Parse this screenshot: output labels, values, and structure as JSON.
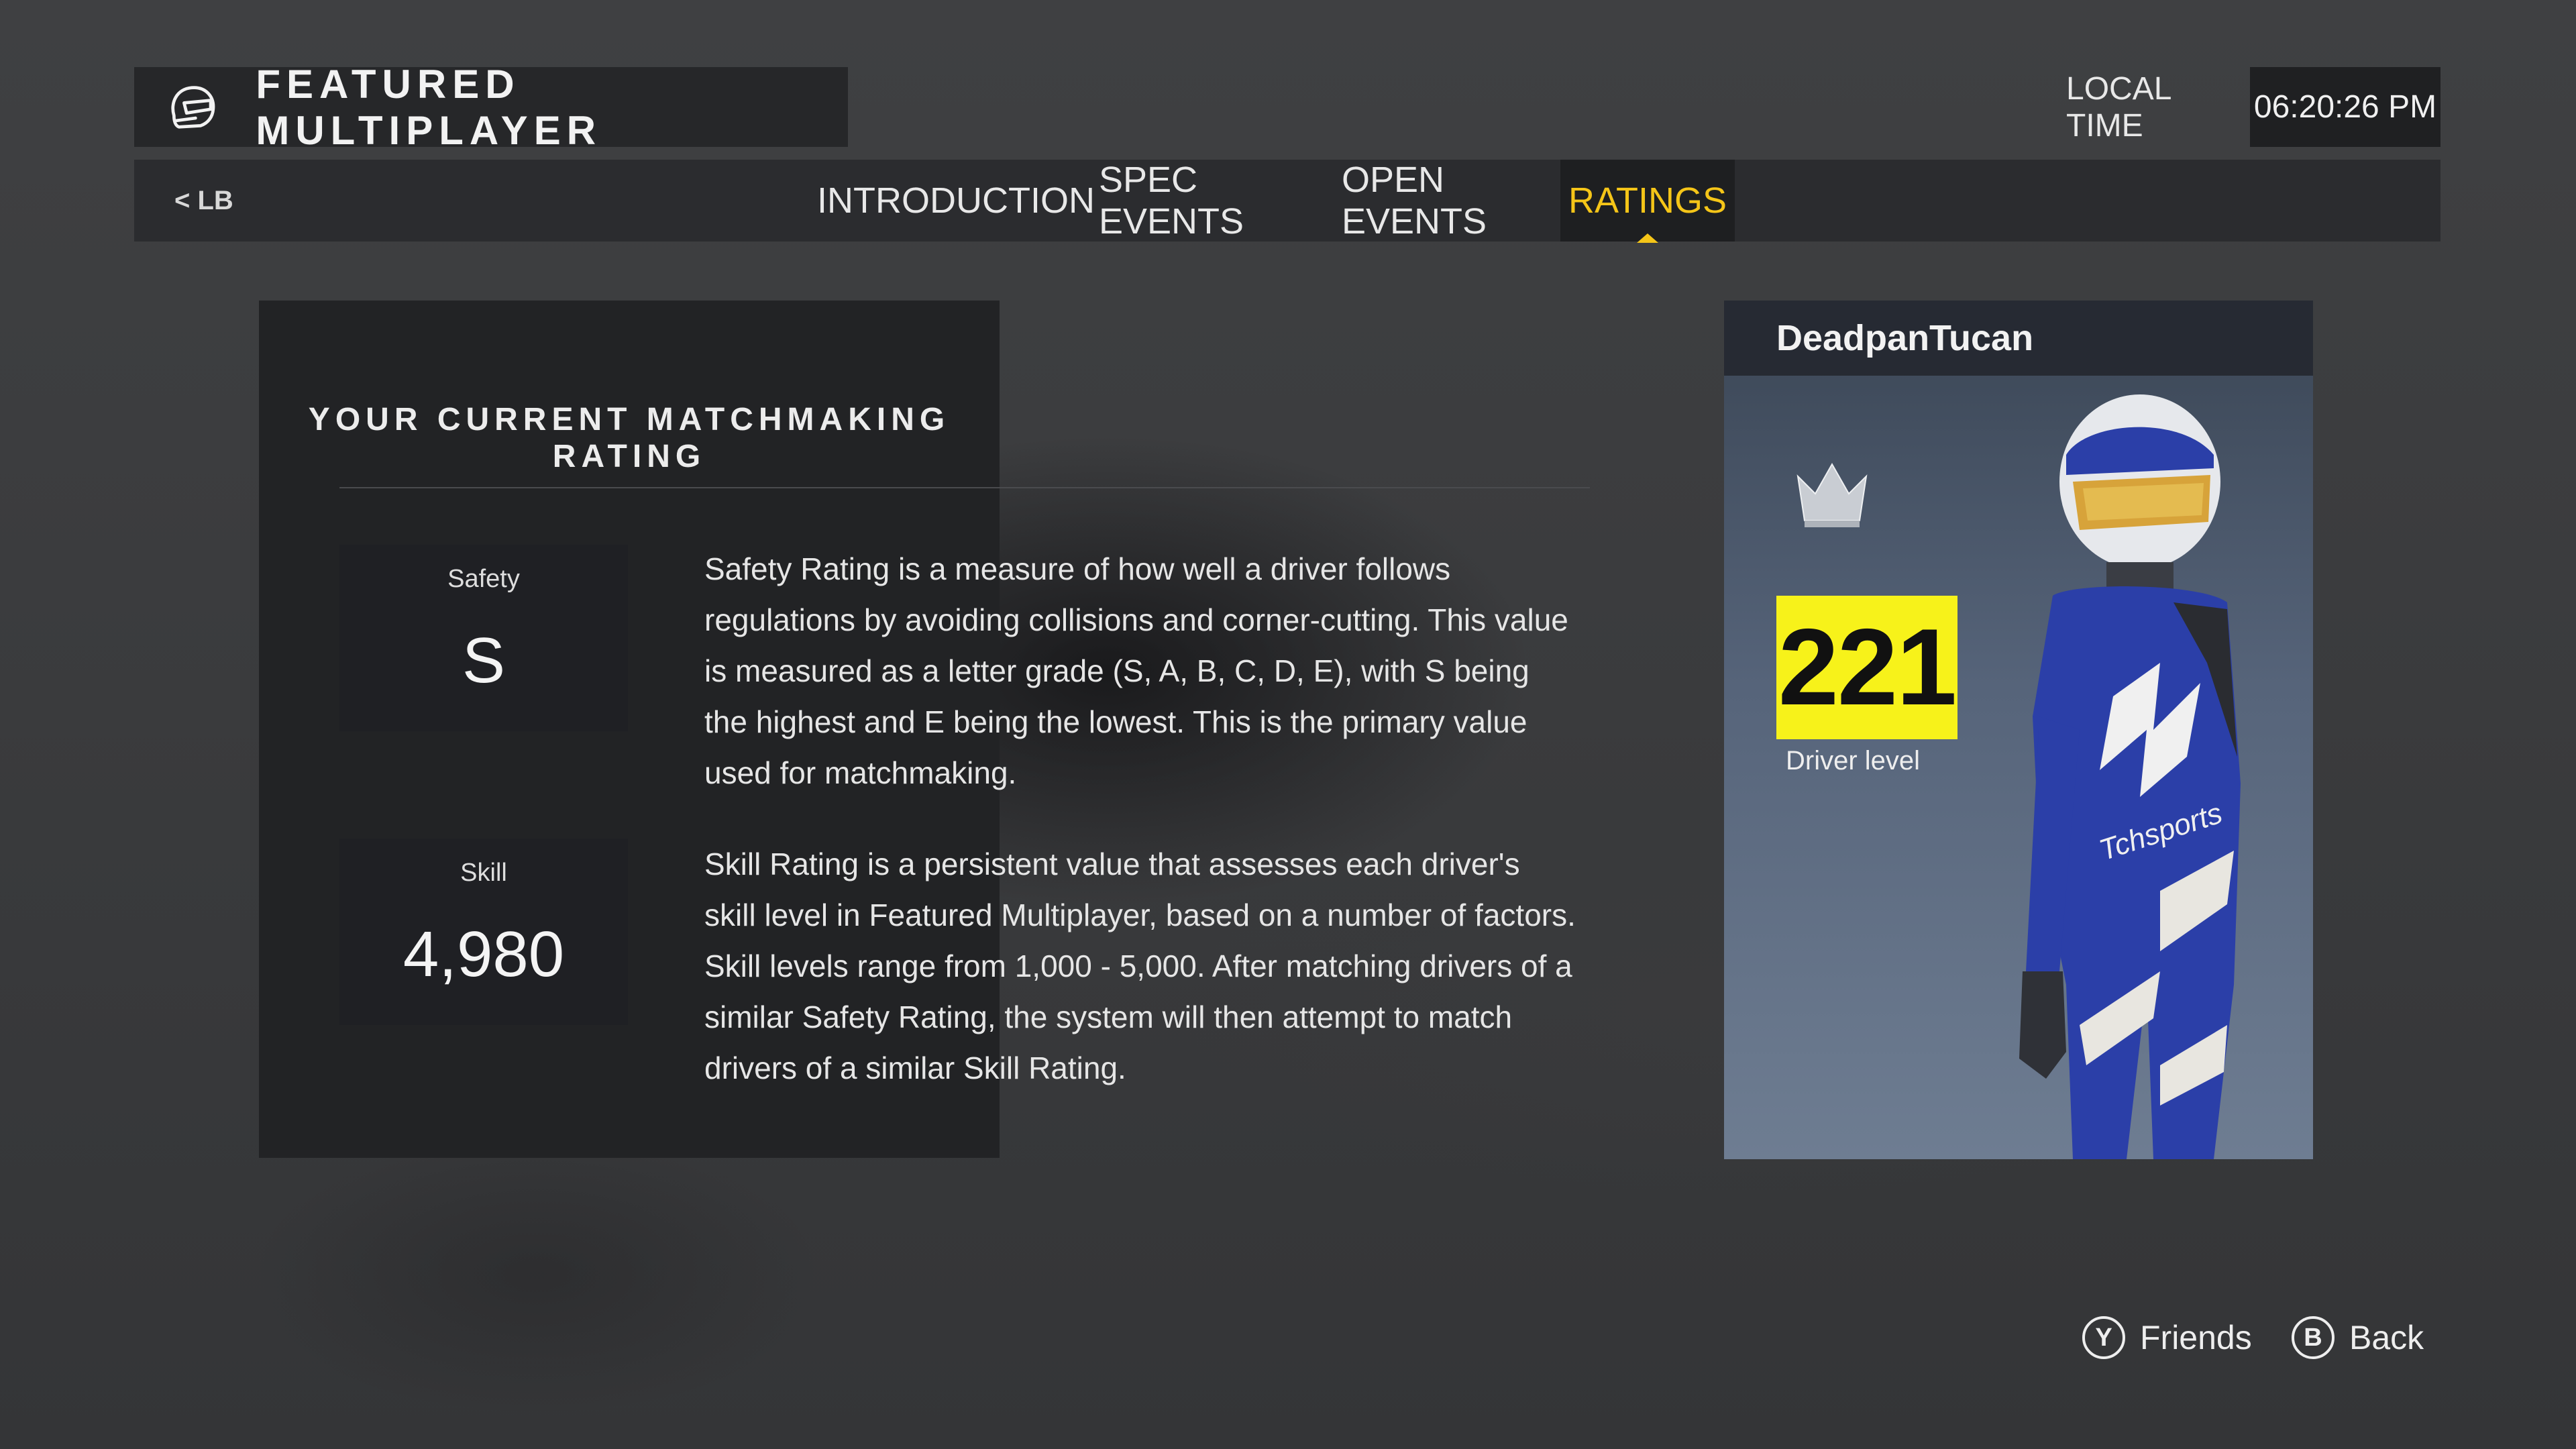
{
  "header": {
    "title": "FEATURED MULTIPLAYER",
    "local_time_label": "LOCAL TIME",
    "local_time_value": "06:20:26 PM"
  },
  "tabs": {
    "back_label": "< LB",
    "items": [
      {
        "label": "INTRODUCTION"
      },
      {
        "label": "SPEC EVENTS"
      },
      {
        "label": "OPEN EVENTS"
      },
      {
        "label": "RATINGS"
      }
    ],
    "active": "RATINGS"
  },
  "panel": {
    "heading": "YOUR CURRENT MATCHMAKING RATING",
    "ratings": [
      {
        "label": "Safety",
        "value": "S",
        "description": "Safety Rating is a measure of how well a driver follows regulations by avoiding collisions and corner-cutting. This value is measured as a letter grade (S, A, B, C, D, E), with S being the highest and E being the lowest. This is the primary value used for matchmaking."
      },
      {
        "label": "Skill",
        "value": "4,980",
        "description": "Skill Rating is a persistent value that assesses each driver's skill level in Featured Multiplayer, based on a number of factors. Skill levels range from 1,000 - 5,000. After matching drivers of a similar Safety Rating, the system will then attempt to match drivers of a similar Skill Rating."
      }
    ]
  },
  "profile": {
    "username": "DeadpanTucan",
    "driver_level": "221",
    "driver_level_label": "Driver level"
  },
  "footer": {
    "friends_button": "Y",
    "friends_label": "Friends",
    "back_button": "B",
    "back_label": "Back"
  },
  "colors": {
    "accent": "#f5c518",
    "level_badge": "#f7f21a",
    "suit_blue": "#2b3fa8"
  },
  "icons": {
    "title_icon": "helmet-icon",
    "rank_icon": "crown-icon"
  }
}
